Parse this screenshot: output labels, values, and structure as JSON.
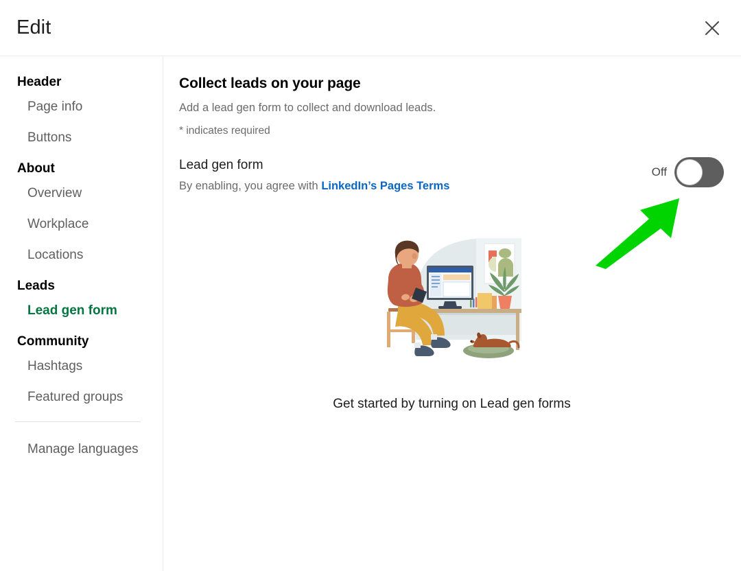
{
  "header": {
    "title": "Edit",
    "close_icon": "close-icon"
  },
  "sidebar": {
    "groups": [
      {
        "title": "Header",
        "items": [
          {
            "label": "Page info",
            "active": false
          },
          {
            "label": "Buttons",
            "active": false
          }
        ]
      },
      {
        "title": "About",
        "items": [
          {
            "label": "Overview",
            "active": false
          },
          {
            "label": "Workplace",
            "active": false
          },
          {
            "label": "Locations",
            "active": false
          }
        ]
      },
      {
        "title": "Leads",
        "items": [
          {
            "label": "Lead gen form",
            "active": true
          }
        ]
      },
      {
        "title": "Community",
        "items": [
          {
            "label": "Hashtags",
            "active": false
          },
          {
            "label": "Featured groups",
            "active": false
          }
        ]
      }
    ],
    "footer_item": {
      "label": "Manage languages"
    },
    "active_color": "#057642"
  },
  "main": {
    "section_title": "Collect leads on your page",
    "section_subtitle": "Add a lead gen form to collect and download leads.",
    "required_note": "* indicates required",
    "field": {
      "label": "Lead gen form",
      "help_prefix": "By enabling, you agree with ",
      "help_link": "LinkedIn’s Pages Terms",
      "link_color": "#0a66c2"
    },
    "toggle": {
      "state_label": "Off",
      "enabled": false,
      "track_color": "#5e5e5e",
      "knob_color": "#ffffff"
    },
    "empty_state": {
      "caption": "Get started by turning on Lead gen forms",
      "illustration_name": "person-at-desk-with-dog-illustration"
    }
  },
  "annotation": {
    "arrow_color": "#00d400",
    "arrow_name": "green-pointer-arrow",
    "points_to": "lead-gen-form-toggle"
  }
}
